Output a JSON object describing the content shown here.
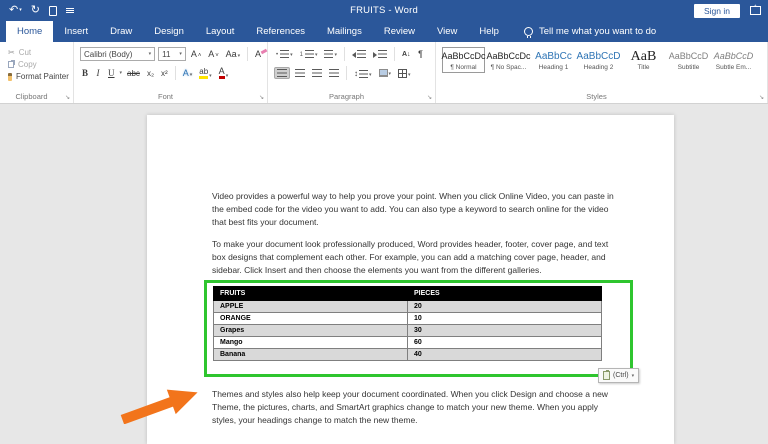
{
  "titlebar": {
    "title": "FRUITS  -  Word",
    "sign_in_label": "Sign in",
    "qat_icons": [
      "undo-icon",
      "redo-icon",
      "new-document-icon",
      "customize-quick-access-icon"
    ]
  },
  "tabs": [
    {
      "label": "Home",
      "active": true
    },
    {
      "label": "Insert"
    },
    {
      "label": "Draw"
    },
    {
      "label": "Design"
    },
    {
      "label": "Layout"
    },
    {
      "label": "References"
    },
    {
      "label": "Mailings"
    },
    {
      "label": "Review"
    },
    {
      "label": "View"
    },
    {
      "label": "Help"
    }
  ],
  "tell_me": "Tell me what you want to do",
  "ribbon": {
    "clipboard": {
      "label": "Clipboard",
      "cut": "Cut",
      "copy": "Copy",
      "format_painter": "Format Painter"
    },
    "font": {
      "label": "Font",
      "font_name": "Calibri (Body)",
      "font_size": "11",
      "bold": "B",
      "italic": "I",
      "underline": "U",
      "strikethrough": "abc",
      "subscript": "x₂",
      "superscript": "x²",
      "grow_font": "A",
      "shrink_font": "A",
      "change_case": "Aa",
      "clear_formatting": "A",
      "text_effects": "A",
      "highlight": "ab",
      "font_color": "A"
    },
    "paragraph": {
      "label": "Paragraph",
      "sort": "A↓",
      "pilcrow": "¶",
      "bullet_prefix": "•",
      "number_prefix": "1"
    },
    "styles": {
      "label": "Styles",
      "items": [
        {
          "sample": "AaBbCcDc",
          "label": "¶ Normal",
          "selected": true
        },
        {
          "sample": "AaBbCcDc",
          "label": "¶ No Spac..."
        },
        {
          "sample": "AaBbCc",
          "label": "Heading 1"
        },
        {
          "sample": "AaBbCcD",
          "label": "Heading 2"
        },
        {
          "sample": "AaB",
          "label": "Title"
        },
        {
          "sample": "AaBbCcD",
          "label": "Subtitle"
        },
        {
          "sample": "AaBbCcD",
          "label": "Subtle Em..."
        }
      ]
    }
  },
  "document": {
    "paragraphs": [
      "Video provides a powerful way to help you prove your point. When you click Online Video, you can paste in the embed code for the video you want to add. You can also type a keyword to search online for the video that best fits your document.",
      "To make your document look professionally produced, Word provides header, footer, cover page, and text box designs that complement each other. For example, you can add a matching cover page, header, and sidebar. Click Insert and then choose the elements you want from the different galleries.",
      "Themes and styles also help keep your document coordinated. When you click Design and choose a new Theme, the pictures, charts, and SmartArt graphics change to match your new theme. When you apply styles, your headings change to match the new theme."
    ],
    "table": {
      "headers": [
        "FRUITS",
        "PIECES"
      ],
      "rows": [
        {
          "fruit": "APPLE",
          "pieces": "20"
        },
        {
          "fruit": "ORANGE",
          "pieces": "10"
        },
        {
          "fruit": "Grapes",
          "pieces": "30"
        },
        {
          "fruit": "Mango",
          "pieces": "60"
        },
        {
          "fruit": "Banana",
          "pieces": "40"
        }
      ]
    },
    "paste_options_label": "(Ctrl)"
  },
  "colors": {
    "title_bar": "#2b579a",
    "highlight_box": "#2fc52f",
    "annotation_arrow": "#f2741b",
    "table_header_bg": "#000000",
    "table_row_shaded": "#d9d9d9"
  }
}
